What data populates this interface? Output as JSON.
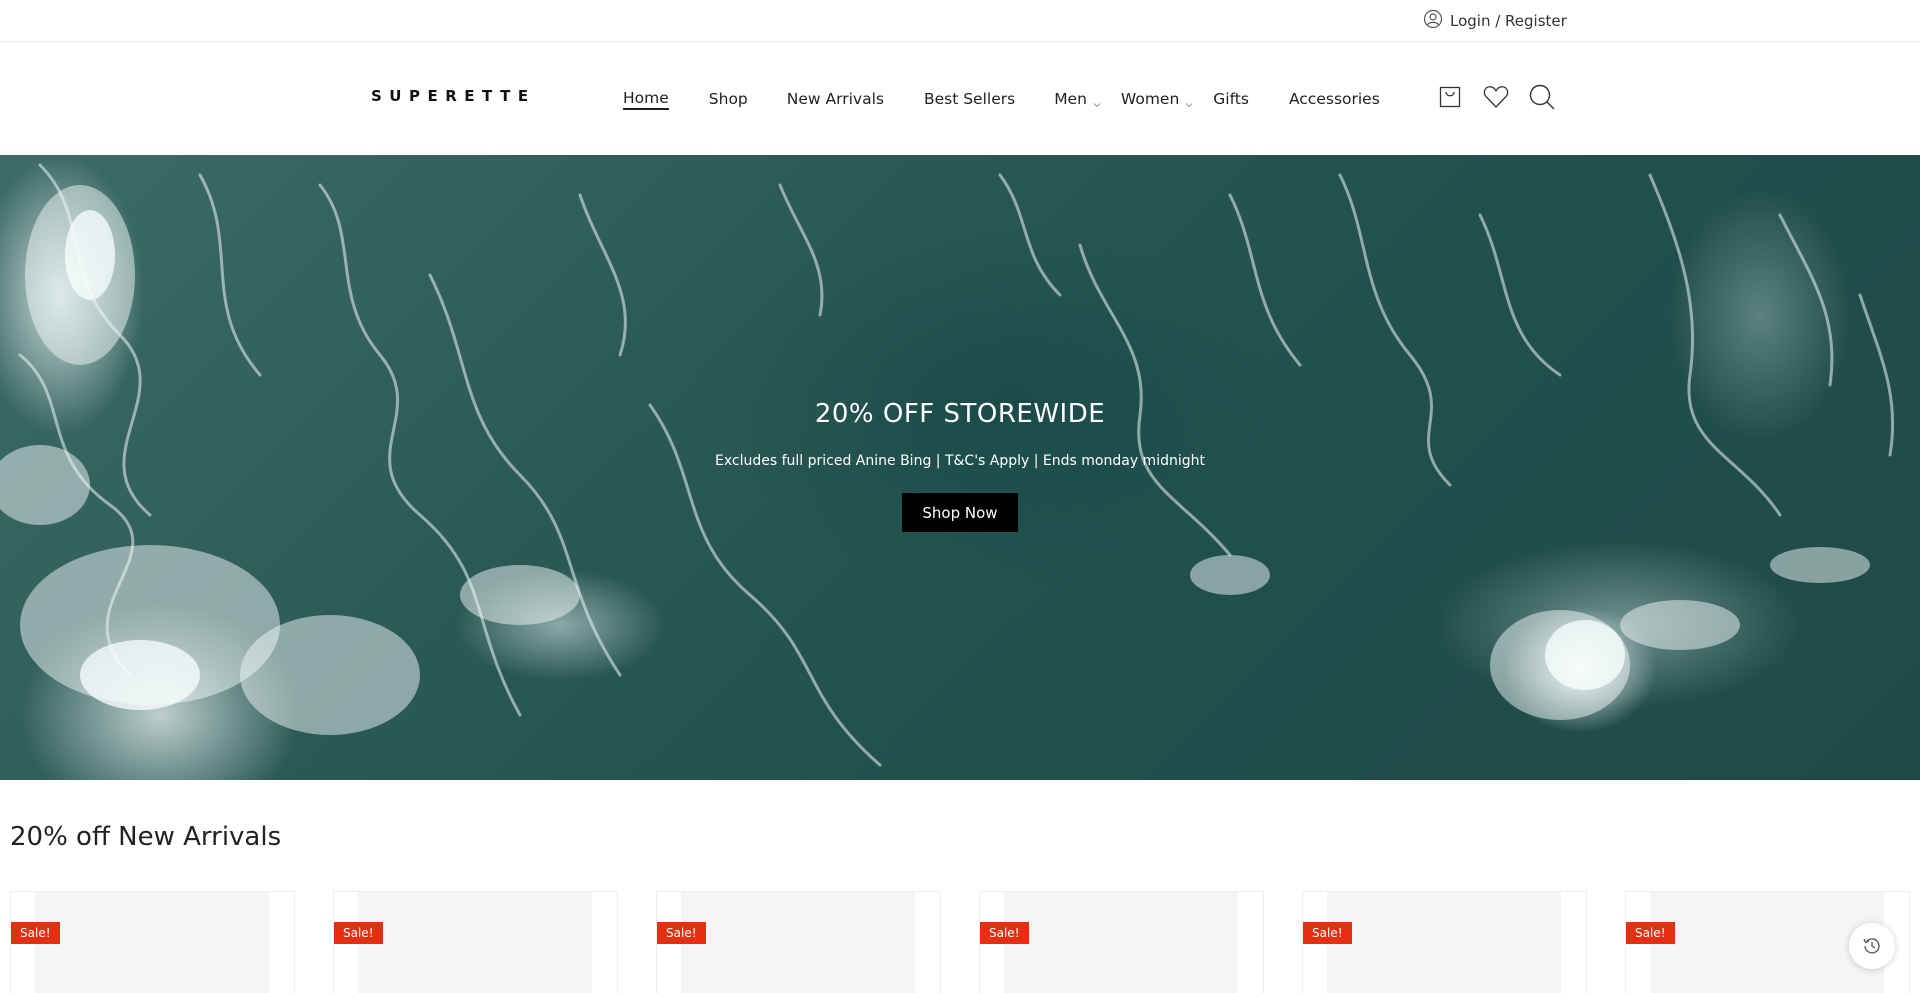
{
  "topbar": {
    "login_label": "Login / Register",
    "user_icon": "user-circle-icon"
  },
  "header": {
    "logo": "SUPERETTE",
    "nav": [
      {
        "label": "Home",
        "active": true,
        "dropdown": false
      },
      {
        "label": "Shop",
        "active": false,
        "dropdown": false
      },
      {
        "label": "New Arrivals",
        "active": false,
        "dropdown": false
      },
      {
        "label": "Best Sellers",
        "active": false,
        "dropdown": false
      },
      {
        "label": "Men",
        "active": false,
        "dropdown": true
      },
      {
        "label": "Women",
        "active": false,
        "dropdown": true
      },
      {
        "label": "Gifts",
        "active": false,
        "dropdown": false
      },
      {
        "label": "Accessories",
        "active": false,
        "dropdown": false
      }
    ],
    "icons": [
      "cart-icon",
      "heart-icon",
      "search-icon"
    ]
  },
  "hero": {
    "title": "20% OFF STOREWIDE",
    "subtitle": "Excludes full priced Anine Bing | T&C's Apply | Ends monday midnight",
    "button_label": "Shop Now"
  },
  "section": {
    "title": "20% off New Arrivals",
    "products": [
      {
        "badge": "Sale!"
      },
      {
        "badge": "Sale!"
      },
      {
        "badge": "Sale!"
      },
      {
        "badge": "Sale!"
      },
      {
        "badge": "Sale!"
      },
      {
        "badge": "Sale!"
      }
    ]
  },
  "floating": {
    "history_icon": "history-icon"
  },
  "colors": {
    "sale_badge": "#e62e12",
    "button_bg": "#000000",
    "hero_water": "#2b5955"
  }
}
